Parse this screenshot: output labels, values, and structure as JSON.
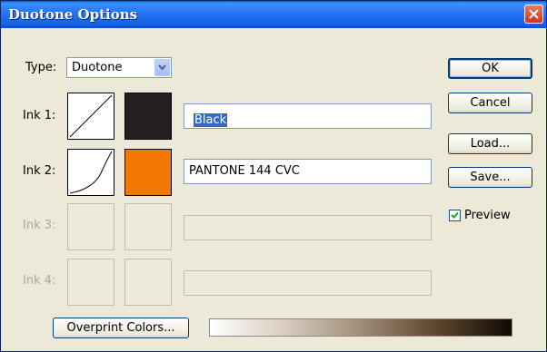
{
  "window": {
    "title": "Duotone Options"
  },
  "type": {
    "label": "Type:",
    "value": "Duotone"
  },
  "inks": [
    {
      "label": "Ink 1:",
      "name": "Black",
      "color": "#231f20",
      "enabled": true
    },
    {
      "label": "Ink 2:",
      "name": "PANTONE 144 CVC",
      "color": "#f07800",
      "enabled": true
    },
    {
      "label": "Ink 3:",
      "name": "",
      "enabled": false
    },
    {
      "label": "Ink 4:",
      "name": "",
      "enabled": false
    }
  ],
  "buttons": {
    "ok": "OK",
    "cancel": "Cancel",
    "load": "Load...",
    "save": "Save...",
    "overprint": "Overprint Colors..."
  },
  "preview": {
    "label": "Preview",
    "checked": true
  }
}
